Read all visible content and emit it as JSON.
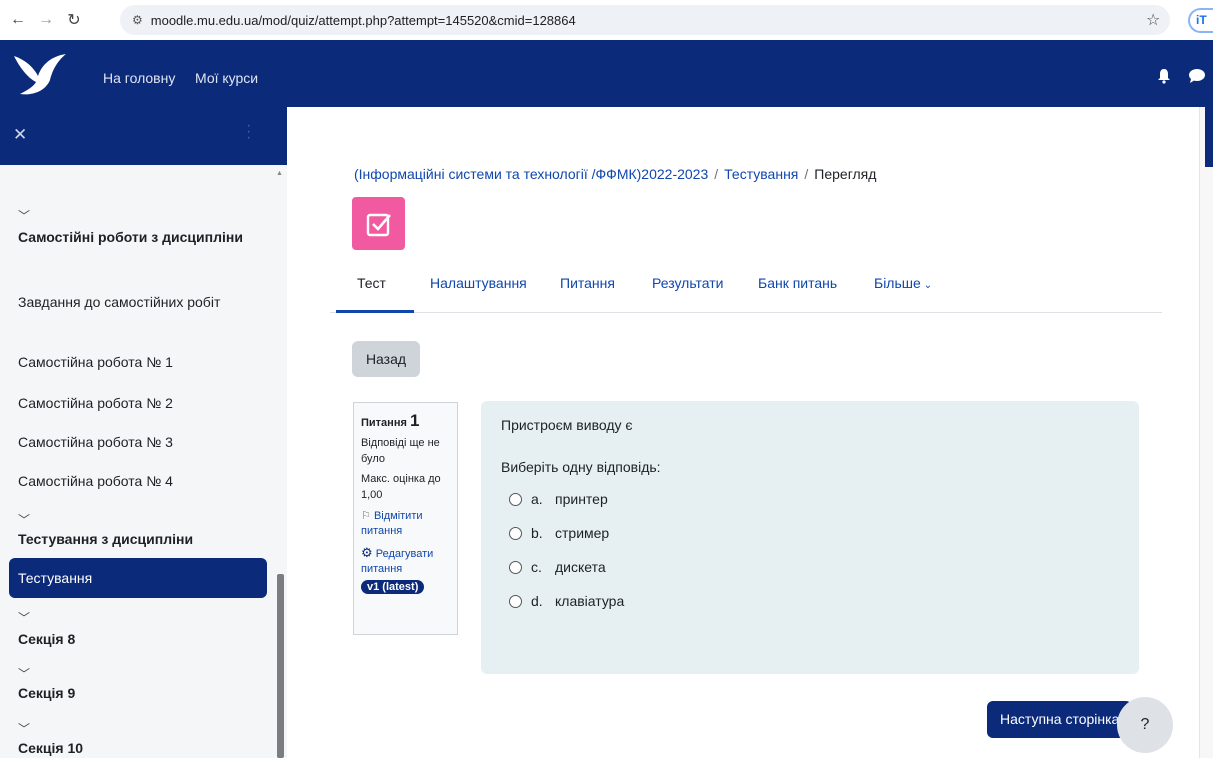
{
  "browser": {
    "url": "moodle.mu.edu.ua/mod/quiz/attempt.php?attempt=145520&cmid=128864",
    "ext_label": "iT"
  },
  "topnav": {
    "links": [
      "На головну",
      "Мої курси"
    ]
  },
  "sidebar": {
    "sections": [
      {
        "title": "Самостійні роботи з дисципліни",
        "items": [
          "Завдання до самостійних робіт",
          "Самостійна робота № 1",
          "Самостійна робота № 2",
          "Самостійна робота № 3",
          "Самостійна робота № 4"
        ]
      },
      {
        "title": "Тестування з дисципліни",
        "active_item": "Тестування"
      },
      {
        "title": "Секція 8"
      },
      {
        "title": "Секція 9"
      },
      {
        "title": "Секція 10"
      }
    ]
  },
  "breadcrumb": {
    "course": "(Інформаційні системи та технології /ФФМК)2022-2023",
    "activity": "Тестування",
    "current": "Перегляд"
  },
  "tabs": [
    "Тест",
    "Налаштування",
    "Питання",
    "Результати",
    "Банк питань",
    "Більше"
  ],
  "back_label": "Назад",
  "question_info": {
    "title": "Питання",
    "number": "1",
    "status": "Відповіді ще не було",
    "max_grade": "Макс. оцінка до 1,00",
    "flag_label": "Відмітити питання",
    "edit_label": "Редагувати питання",
    "version_badge": "v1 (latest)"
  },
  "question": {
    "text": "Пристроєм виводу є",
    "prompt": "Виберіть одну відповідь:",
    "options": [
      {
        "letter": "a.",
        "text": "принтер"
      },
      {
        "letter": "b.",
        "text": "стример"
      },
      {
        "letter": "c.",
        "text": "дискета"
      },
      {
        "letter": "d.",
        "text": "клавіатура"
      }
    ]
  },
  "next_label": "Наступна сторінка",
  "help_label": "?",
  "colors": {
    "brand": "#0b2a7a",
    "link": "#0f47ad",
    "quiz_icon": "#f15aa0",
    "question_bg": "#e6f0f3"
  }
}
